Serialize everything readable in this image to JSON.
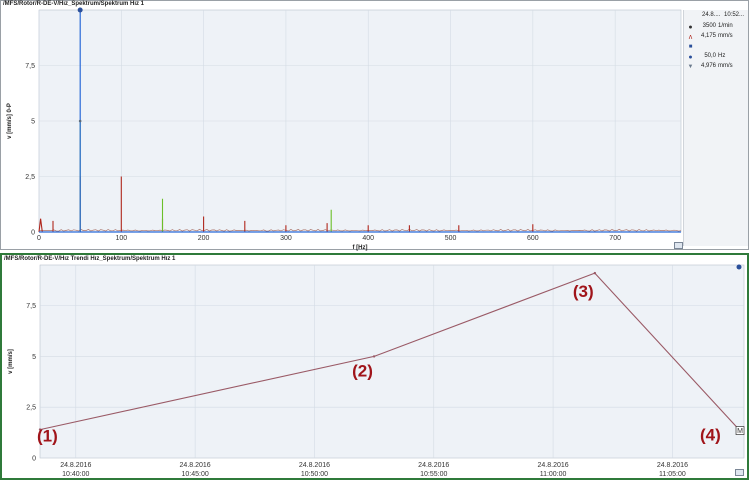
{
  "top_panel": {
    "title": "/MFS/Rotor/R-DE-V/Hız_Spektrum/Spektrum Hız 1",
    "legend": {
      "date": "24.8....",
      "time": "10:52...",
      "rows": [
        {
          "icon": "circle-dark-icon",
          "value": "3500",
          "unit": "1/min"
        },
        {
          "icon": "spectrum-line-icon",
          "value": "4,175",
          "unit": "mm/s"
        },
        {
          "icon": "square-blue-icon",
          "value": "",
          "unit": ""
        },
        {
          "icon": "circle-blue-icon",
          "value": "50,0",
          "unit": "Hz"
        },
        {
          "icon": "triangle-icon",
          "value": "4,976",
          "unit": "mm/s"
        }
      ]
    }
  },
  "bottom_panel": {
    "title": "/MFS/Rotor/R-DE-V/Hız Trendi Hız_Spektrum/Spektrum Hız 1",
    "marker_label": "M",
    "annotations": [
      "(1)",
      "(2)",
      "(3)",
      "(4)"
    ]
  },
  "chart_data": [
    {
      "type": "line",
      "title": "",
      "xlabel": "f [Hz]",
      "ylabel": "v [mm/s] 0-P",
      "xlim": [
        0,
        780
      ],
      "ylim": [
        0,
        10
      ],
      "x_ticks": [
        "0",
        "100",
        "200",
        "300",
        "400",
        "500",
        "600",
        "700"
      ],
      "y_ticks": [
        "0",
        "2,5",
        "5",
        "7,5"
      ],
      "grid": true,
      "series": [
        {
          "color": "#2a6ad8",
          "x": [
            0,
            50,
            50,
            50,
            780
          ],
          "y": [
            0,
            0,
            10.0,
            0,
            0
          ]
        },
        {
          "color": "#6bbf2a",
          "x": [
            0,
            50,
            50,
            50,
            150,
            150,
            150,
            355,
            355,
            355,
            780
          ],
          "y": [
            0,
            0,
            5.0,
            0,
            0,
            1.5,
            0,
            0,
            1.0,
            0,
            0
          ]
        },
        {
          "color": "#b0261c",
          "x": [
            0,
            2,
            4,
            17,
            17,
            17,
            50,
            50,
            50,
            100,
            100,
            100,
            150,
            150,
            150,
            200,
            200,
            200,
            250,
            250,
            250,
            300,
            300,
            300,
            350,
            350,
            350,
            400,
            400,
            400,
            450,
            450,
            450,
            510,
            510,
            510,
            600,
            600,
            600,
            780
          ],
          "y": [
            0,
            0.6,
            0,
            0,
            0.5,
            0,
            0,
            2.5,
            0,
            0,
            2.5,
            0,
            0,
            0.6,
            0,
            0,
            0.7,
            0,
            0,
            0.5,
            0,
            0,
            0.3,
            0,
            0,
            0.4,
            0,
            0,
            0.3,
            0,
            0,
            0.3,
            0,
            0,
            0.3,
            0,
            0,
            0.35,
            0,
            0
          ]
        }
      ],
      "series_note_cursor_hz": 50
    },
    {
      "type": "line",
      "title": "",
      "xlabel": "",
      "ylabel": "v [mm/s]",
      "xlim": [
        "24.8.2016 10:38:30",
        "24.8.2016 11:08:00"
      ],
      "ylim": [
        0,
        9.5
      ],
      "x_ticks": [
        {
          "date": "24.8.2016",
          "time": "10:40:00"
        },
        {
          "date": "24.8.2016",
          "time": "10:45:00"
        },
        {
          "date": "24.8.2016",
          "time": "10:50:00"
        },
        {
          "date": "24.8.2016",
          "time": "10:55:00"
        },
        {
          "date": "24.8.2016",
          "time": "11:00:00"
        },
        {
          "date": "24.8.2016",
          "time": "11:05:00"
        }
      ],
      "y_ticks": [
        "0",
        "2,5",
        "5",
        "7,5"
      ],
      "grid": true,
      "series": [
        {
          "color": "#9a5a66",
          "x": [
            "24.8.2016 10:38:30",
            "24.8.2016 10:52:30",
            "24.8.2016 11:01:45",
            "24.8.2016 11:07:50"
          ],
          "y": [
            1.4,
            5.0,
            9.1,
            1.35
          ]
        }
      ]
    }
  ]
}
